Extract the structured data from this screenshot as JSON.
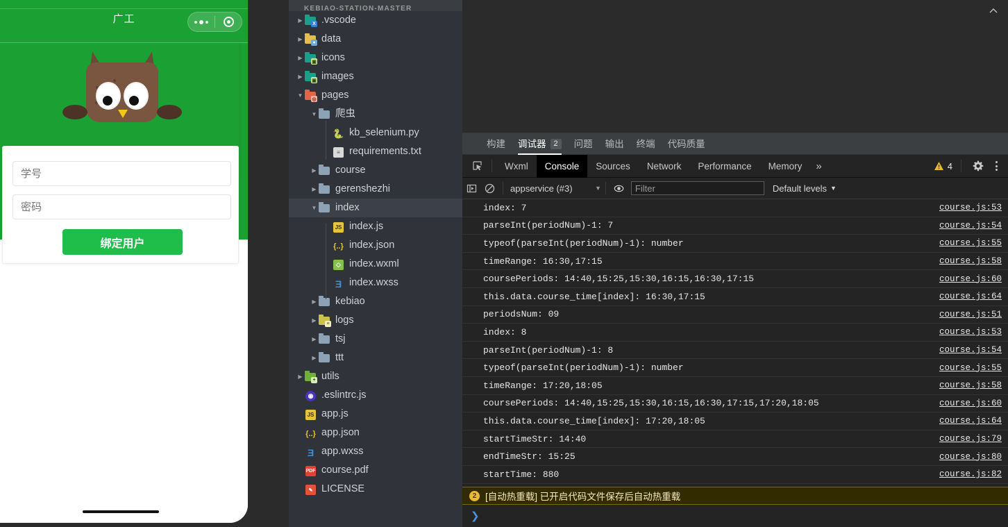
{
  "simulator": {
    "nav_title": "广工",
    "capsule": {
      "menu_icon": "more-dots-icon",
      "target_icon": "target-circle-icon"
    },
    "mascot_icon": "owl-mascot-icon",
    "form": {
      "student_id_placeholder": "学号",
      "student_id_value": "",
      "password_placeholder": "密码",
      "password_value": "",
      "submit_label": "绑定用户"
    },
    "home_indicator": "home-indicator"
  },
  "explorer": {
    "header_title": "KEBIAO-STATION-MASTER",
    "items": [
      {
        "label": ".vscode",
        "indent": 1,
        "type": "folder",
        "icon": "folder-vscode-icon",
        "color": "teal",
        "arrow": "collapsed",
        "selected": false
      },
      {
        "label": "data",
        "indent": 1,
        "type": "folder",
        "icon": "folder-data-icon",
        "color": "yellow",
        "arrow": "collapsed",
        "selected": false
      },
      {
        "label": "icons",
        "indent": 1,
        "type": "folder",
        "icon": "folder-images-icon",
        "color": "teal",
        "arrow": "collapsed",
        "selected": false
      },
      {
        "label": "images",
        "indent": 1,
        "type": "folder",
        "icon": "folder-images-icon",
        "color": "teal",
        "arrow": "collapsed",
        "selected": false
      },
      {
        "label": "pages",
        "indent": 1,
        "type": "folder",
        "icon": "folder-pages-icon",
        "color": "red",
        "arrow": "expanded",
        "selected": false
      },
      {
        "label": "爬虫",
        "indent": 2,
        "type": "folder",
        "icon": "folder-open-icon",
        "color": "grey",
        "arrow": "expanded",
        "selected": false
      },
      {
        "label": "kb_selenium.py",
        "indent": 3,
        "type": "file",
        "icon": "python-file-icon",
        "color": "py",
        "arrow": "none",
        "selected": false
      },
      {
        "label": "requirements.txt",
        "indent": 3,
        "type": "file",
        "icon": "text-file-icon",
        "color": "txt",
        "arrow": "none",
        "selected": false
      },
      {
        "label": "course",
        "indent": 2,
        "type": "folder",
        "icon": "folder-icon",
        "color": "grey",
        "arrow": "collapsed",
        "selected": false
      },
      {
        "label": "gerenshezhi",
        "indent": 2,
        "type": "folder",
        "icon": "folder-icon",
        "color": "grey",
        "arrow": "collapsed",
        "selected": false
      },
      {
        "label": "index",
        "indent": 2,
        "type": "folder",
        "icon": "folder-open-icon",
        "color": "grey",
        "arrow": "expanded",
        "selected": true
      },
      {
        "label": "index.js",
        "indent": 3,
        "type": "file",
        "icon": "js-file-icon",
        "color": "js",
        "arrow": "none",
        "selected": false
      },
      {
        "label": "index.json",
        "indent": 3,
        "type": "file",
        "icon": "json-file-icon",
        "color": "json",
        "arrow": "none",
        "selected": false
      },
      {
        "label": "index.wxml",
        "indent": 3,
        "type": "file",
        "icon": "wxml-file-icon",
        "color": "wxml",
        "arrow": "none",
        "selected": false
      },
      {
        "label": "index.wxss",
        "indent": 3,
        "type": "file",
        "icon": "wxss-file-icon",
        "color": "wxss",
        "arrow": "none",
        "selected": false
      },
      {
        "label": "kebiao",
        "indent": 2,
        "type": "folder",
        "icon": "folder-icon",
        "color": "grey",
        "arrow": "collapsed",
        "selected": false
      },
      {
        "label": "logs",
        "indent": 2,
        "type": "folder",
        "icon": "folder-logs-icon",
        "color": "olive",
        "arrow": "collapsed",
        "selected": false
      },
      {
        "label": "tsj",
        "indent": 2,
        "type": "folder",
        "icon": "folder-icon",
        "color": "grey",
        "arrow": "collapsed",
        "selected": false
      },
      {
        "label": "ttt",
        "indent": 2,
        "type": "folder",
        "icon": "folder-icon",
        "color": "grey",
        "arrow": "collapsed",
        "selected": false
      },
      {
        "label": "utils",
        "indent": 1,
        "type": "folder",
        "icon": "folder-utils-icon",
        "color": "green",
        "arrow": "collapsed",
        "selected": false
      },
      {
        "label": ".eslintrc.js",
        "indent": 1,
        "type": "file",
        "icon": "eslint-file-icon",
        "color": "eslint",
        "arrow": "none",
        "selected": false
      },
      {
        "label": "app.js",
        "indent": 1,
        "type": "file",
        "icon": "js-file-icon",
        "color": "js",
        "arrow": "none",
        "selected": false
      },
      {
        "label": "app.json",
        "indent": 1,
        "type": "file",
        "icon": "json-file-icon",
        "color": "json",
        "arrow": "none",
        "selected": false
      },
      {
        "label": "app.wxss",
        "indent": 1,
        "type": "file",
        "icon": "wxss-file-icon",
        "color": "wxss",
        "arrow": "none",
        "selected": false
      },
      {
        "label": "course.pdf",
        "indent": 1,
        "type": "file",
        "icon": "pdf-file-icon",
        "color": "pdf",
        "arrow": "none",
        "selected": false
      },
      {
        "label": "LICENSE",
        "indent": 1,
        "type": "file",
        "icon": "license-file-icon",
        "color": "lic",
        "arrow": "none",
        "selected": false
      }
    ]
  },
  "devtools": {
    "panel_tabs": [
      {
        "label": "构建",
        "badge": "",
        "active": false
      },
      {
        "label": "调试器",
        "badge": "2",
        "active": true
      },
      {
        "label": "问题",
        "badge": "",
        "active": false
      },
      {
        "label": "输出",
        "badge": "",
        "active": false
      },
      {
        "label": "终端",
        "badge": "",
        "active": false
      },
      {
        "label": "代码质量",
        "badge": "",
        "active": false
      }
    ],
    "collapse_icon": "chevron-up-icon",
    "inspect_icon": "inspect-element-icon",
    "devtool_tabs": [
      {
        "label": "Wxml",
        "active": false
      },
      {
        "label": "Console",
        "active": true
      },
      {
        "label": "Sources",
        "active": false
      },
      {
        "label": "Network",
        "active": false
      },
      {
        "label": "Performance",
        "active": false
      },
      {
        "label": "Memory",
        "active": false
      }
    ],
    "more_tabs_label": "»",
    "warning_icon": "warning-triangle-icon",
    "warning_count": "4",
    "settings_icon": "gear-icon",
    "kebab_icon": "more-vertical-icon",
    "filterbar": {
      "sidebar_icon": "console-sidebar-icon",
      "clear_icon": "clear-console-icon",
      "context_value": "appservice (#3)",
      "context_caret": "▼",
      "eye_icon": "live-expression-icon",
      "filter_placeholder": "Filter",
      "filter_value": "",
      "levels_label": "Default levels",
      "levels_caret": "▼"
    },
    "log_entries": [
      {
        "message": "index: 7",
        "source": "course.js:53"
      },
      {
        "message": "parseInt(periodNum)-1: 7",
        "source": "course.js:54"
      },
      {
        "message": "typeof(parseInt(periodNum)-1): number",
        "source": "course.js:55"
      },
      {
        "message": "timeRange: 16:30,17:15",
        "source": "course.js:58"
      },
      {
        "message": "coursePeriods: 14:40,15:25,15:30,16:15,16:30,17:15",
        "source": "course.js:60"
      },
      {
        "message": "this.data.course_time[index]: 16:30,17:15",
        "source": "course.js:64"
      },
      {
        "message": "periodsNum: 09",
        "source": "course.js:51"
      },
      {
        "message": "index: 8",
        "source": "course.js:53"
      },
      {
        "message": "parseInt(periodNum)-1: 8",
        "source": "course.js:54"
      },
      {
        "message": "typeof(parseInt(periodNum)-1): number",
        "source": "course.js:55"
      },
      {
        "message": "timeRange: 17:20,18:05",
        "source": "course.js:58"
      },
      {
        "message": "coursePeriods: 14:40,15:25,15:30,16:15,16:30,17:15,17:20,18:05",
        "source": "course.js:60"
      },
      {
        "message": "this.data.course_time[index]: 17:20,18:05",
        "source": "course.js:64"
      },
      {
        "message": "startTimeStr: 14:40",
        "source": "course.js:79"
      },
      {
        "message": "endTimeStr: 15:25",
        "source": "course.js:80"
      },
      {
        "message": "startTime: 880",
        "source": "course.js:82"
      }
    ],
    "warning_row": {
      "count": "2",
      "text": "[自动热重载] 已开启代码文件保存后自动热重载"
    },
    "prompt_caret": "❯"
  },
  "colors": {
    "brand_green": "#1aa033",
    "button_green": "#1fbd4a",
    "accent_warning": "#e8b931",
    "console_bg": "#242424",
    "explorer_bg": "#30343a"
  }
}
